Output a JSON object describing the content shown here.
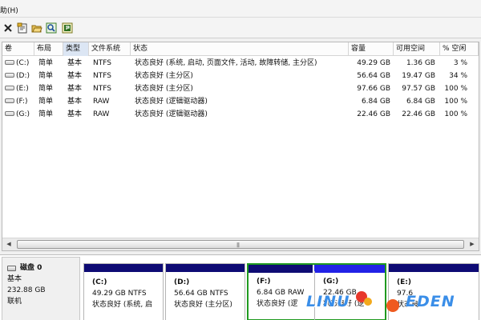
{
  "menubar": {
    "item": "助(H)"
  },
  "toolbar": {
    "icons": [
      "close-icon",
      "properties-icon",
      "open-folder-icon",
      "search-icon",
      "help-icon"
    ]
  },
  "volume_list": {
    "columns": [
      "卷",
      "布局",
      "类型",
      "文件系统",
      "状态",
      "容量",
      "可用空间",
      "% 空闲"
    ],
    "rows": [
      {
        "volume": "(C:)",
        "layout": "简单",
        "type": "基本",
        "fs": "NTFS",
        "status": "状态良好 (系统, 启动, 页面文件, 活动, 故障转储, 主分区)",
        "capacity": "49.29 GB",
        "free": "1.36 GB",
        "pct": "3 %"
      },
      {
        "volume": "(D:)",
        "layout": "简单",
        "type": "基本",
        "fs": "NTFS",
        "status": "状态良好 (主分区)",
        "capacity": "56.64 GB",
        "free": "19.47 GB",
        "pct": "34 %"
      },
      {
        "volume": "(E:)",
        "layout": "简单",
        "type": "基本",
        "fs": "NTFS",
        "status": "状态良好 (主分区)",
        "capacity": "97.66 GB",
        "free": "97.57 GB",
        "pct": "100 %"
      },
      {
        "volume": "(F:)",
        "layout": "简单",
        "type": "基本",
        "fs": "RAW",
        "status": "状态良好 (逻辑驱动器)",
        "capacity": "6.84 GB",
        "free": "6.84 GB",
        "pct": "100 %"
      },
      {
        "volume": "(G:)",
        "layout": "简单",
        "type": "基本",
        "fs": "RAW",
        "status": "状态良好 (逻辑驱动器)",
        "capacity": "22.46 GB",
        "free": "22.46 GB",
        "pct": "100 %"
      }
    ]
  },
  "disk": {
    "name": "磁盘 0",
    "type": "基本",
    "size": "232.88 GB",
    "state": "联机",
    "partitions": [
      {
        "letter": "(C:)",
        "size_fs": "49.29 GB NTFS",
        "status": "状态良好 (系统, 启"
      },
      {
        "letter": "(D:)",
        "size_fs": "56.64 GB NTFS",
        "status": "状态良好 (主分区)"
      },
      {
        "letter": "(F:)",
        "size_fs": "6.84 GB RAW",
        "status": "状态良好 (逻"
      },
      {
        "letter": "(G:)",
        "size_fs": "22.46 GB",
        "status": "状态良好 (逻"
      },
      {
        "letter": "(E:)",
        "size_fs": "97.6",
        "status": "状态良"
      }
    ]
  },
  "watermark": {
    "left": "LINU",
    "right": "EDEN"
  },
  "colors": {
    "primary_bar": "#0e0b74",
    "logical_bar": "#2222e6",
    "selection_border": "#1f9a1f",
    "header_active": "#dce6f4"
  }
}
